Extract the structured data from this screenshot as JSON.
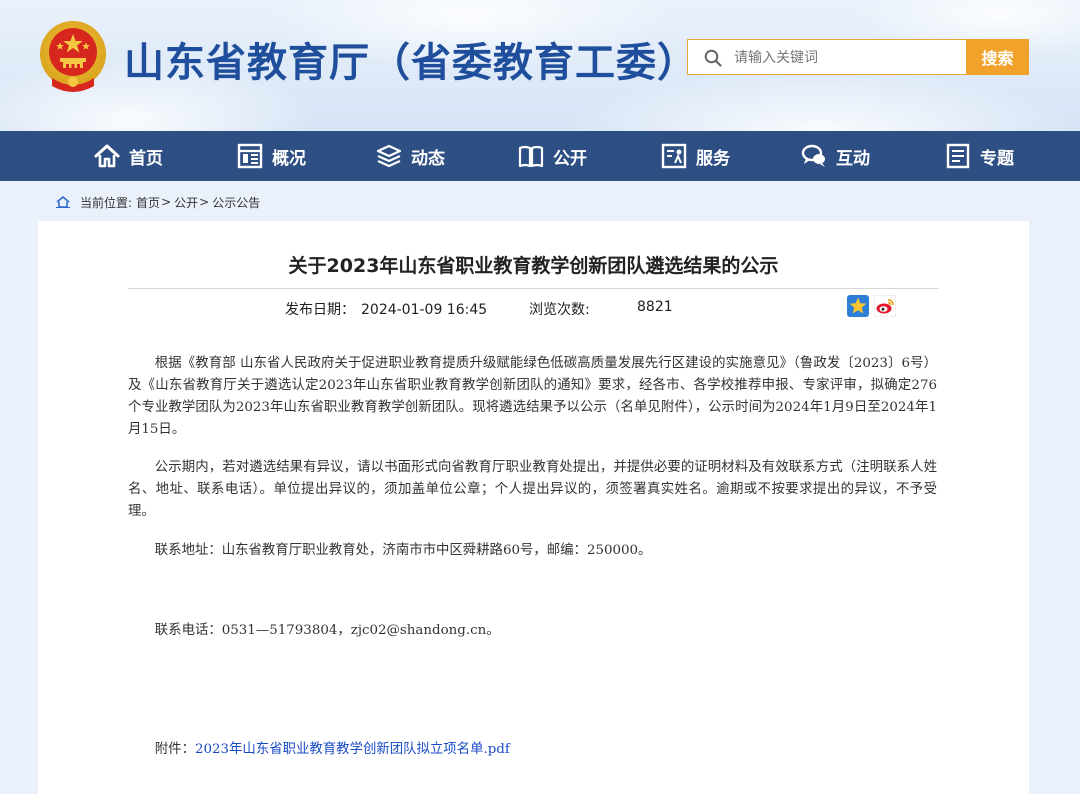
{
  "header": {
    "site_title": "山东省教育厅（省委教育工委）",
    "search_placeholder": "请输入关键词",
    "search_button": "搜索"
  },
  "nav": {
    "items": [
      {
        "label": "首页",
        "icon": "home-icon"
      },
      {
        "label": "概况",
        "icon": "overview-icon"
      },
      {
        "label": "动态",
        "icon": "news-icon"
      },
      {
        "label": "公开",
        "icon": "book-icon"
      },
      {
        "label": "服务",
        "icon": "service-icon"
      },
      {
        "label": "互动",
        "icon": "chat-icon"
      },
      {
        "label": "专题",
        "icon": "topic-icon"
      }
    ]
  },
  "breadcrumb": {
    "prefix": "当前位置:",
    "items": [
      "首页",
      "公开",
      "公示公告"
    ],
    "separator": ">"
  },
  "article": {
    "title": "关于2023年山东省职业教育教学创新团队遴选结果的公示",
    "date_label": "发布日期：",
    "date_value": "2024-01-09 16:45",
    "views_label": "浏览次数:",
    "views_value": "8821",
    "paragraphs": [
      "根据《教育部 山东省人民政府关于促进职业教育提质升级赋能绿色低碳高质量发展先行区建设的实施意见》（鲁政发〔2023〕6号）及《山东省教育厅关于遴选认定2023年山东省职业教育教学创新团队的通知》要求，经各市、各学校推荐申报、专家评审，拟确定276个专业教学团队为2023年山东省职业教育教学创新团队。现将遴选结果予以公示（名单见附件），公示时间为2024年1月9日至2024年1月15日。",
      "公示期内，若对遴选结果有异议，请以书面形式向省教育厅职业教育处提出，并提供必要的证明材料及有效联系方式（注明联系人姓名、地址、联系电话）。单位提出异议的，须加盖单位公章；个人提出异议的，须签署真实姓名。逾期或不按要求提出的异议，不予受理。",
      "联系地址：山东省教育厅职业教育处，济南市市中区舜耕路60号，邮编：250000。",
      "联系电话：0531—51793804，zjc02@shandong.cn。"
    ],
    "attachment_label": "附件：",
    "attachment_link": "2023年山东省职业教育教学创新团队拟立项名单.pdf"
  },
  "colors": {
    "nav_bg": "#2e4f84",
    "title_blue": "#1f4f9c",
    "search_orange": "#f0a22b",
    "link_blue": "#1a4cc4"
  }
}
